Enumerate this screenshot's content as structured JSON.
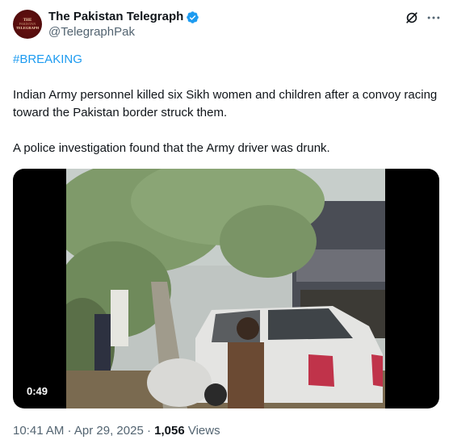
{
  "author": {
    "display_name": "The Pakistan Telegraph",
    "handle": "@TelegraphPak",
    "avatar_text": [
      "THE",
      "PAKISTAN",
      "TELEGRAPH"
    ]
  },
  "post": {
    "hashtag": "#BREAKING",
    "paragraphs": [
      "Indian Army personnel killed six Sikh women and children after a convoy racing toward the Pakistan border struck them.",
      "A police investigation found that the Army driver was drunk."
    ],
    "video": {
      "duration": "0:49"
    }
  },
  "meta": {
    "time": "10:41 AM",
    "separator": " · ",
    "date": "Apr 29, 2025",
    "views_count": "1,056",
    "views_label": " Views"
  },
  "colors": {
    "link": "#1d9bf0",
    "secondary_text": "#536471",
    "verified_badge": "#1d9bf0"
  },
  "icons": [
    "verified-badge-icon",
    "grok-icon",
    "more-options-icon"
  ]
}
